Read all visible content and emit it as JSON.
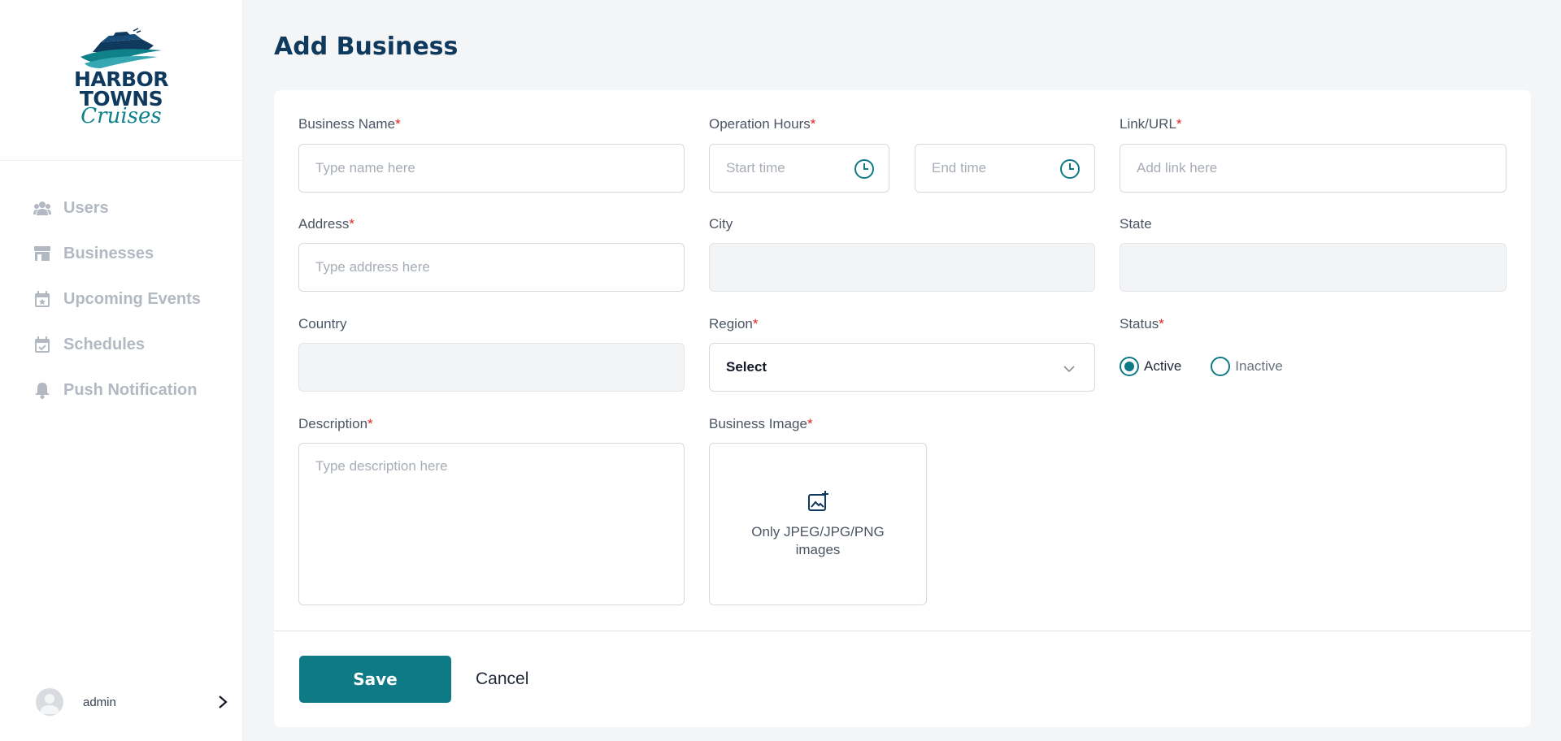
{
  "app": {
    "logo": {
      "line1": "HARBOR",
      "line2": "TOWNS",
      "line3": "Cruises"
    }
  },
  "sidebar": {
    "items": [
      {
        "label": "Users",
        "icon": "users-icon"
      },
      {
        "label": "Businesses",
        "icon": "store-icon"
      },
      {
        "label": "Upcoming Events",
        "icon": "calendar-star-icon"
      },
      {
        "label": "Schedules",
        "icon": "calendar-check-icon"
      },
      {
        "label": "Push Notification",
        "icon": "bell-icon"
      }
    ],
    "user": {
      "name": "admin"
    }
  },
  "page": {
    "title": "Add Business"
  },
  "form": {
    "business_name": {
      "label": "Business Name",
      "placeholder": "Type name here",
      "required": "*"
    },
    "operation_hours": {
      "label": "Operation Hours",
      "start_placeholder": "Start time",
      "end_placeholder": "End time",
      "required": "*"
    },
    "link": {
      "label": "Link/URL",
      "placeholder": "Add link here",
      "required": "*"
    },
    "address": {
      "label": "Address",
      "placeholder": "Type address here",
      "required": "*"
    },
    "city": {
      "label": "City",
      "value": ""
    },
    "state": {
      "label": "State",
      "value": ""
    },
    "country": {
      "label": "Country",
      "value": ""
    },
    "region": {
      "label": "Region",
      "value": "Select",
      "required": "*"
    },
    "status": {
      "label": "Status",
      "required": "*",
      "options": [
        "Active",
        "Inactive"
      ],
      "selected": "Active"
    },
    "description": {
      "label": "Description",
      "placeholder": "Type description here",
      "required": "*"
    },
    "business_image": {
      "label": "Business Image",
      "hint": "Only JPEG/JPG/PNG images",
      "required": "*"
    }
  },
  "actions": {
    "save": "Save",
    "cancel": "Cancel"
  },
  "colors": {
    "primary": "#0e7a85",
    "title": "#0f3a5e",
    "required": "#e02424",
    "nav_text": "#b3b9c2"
  }
}
